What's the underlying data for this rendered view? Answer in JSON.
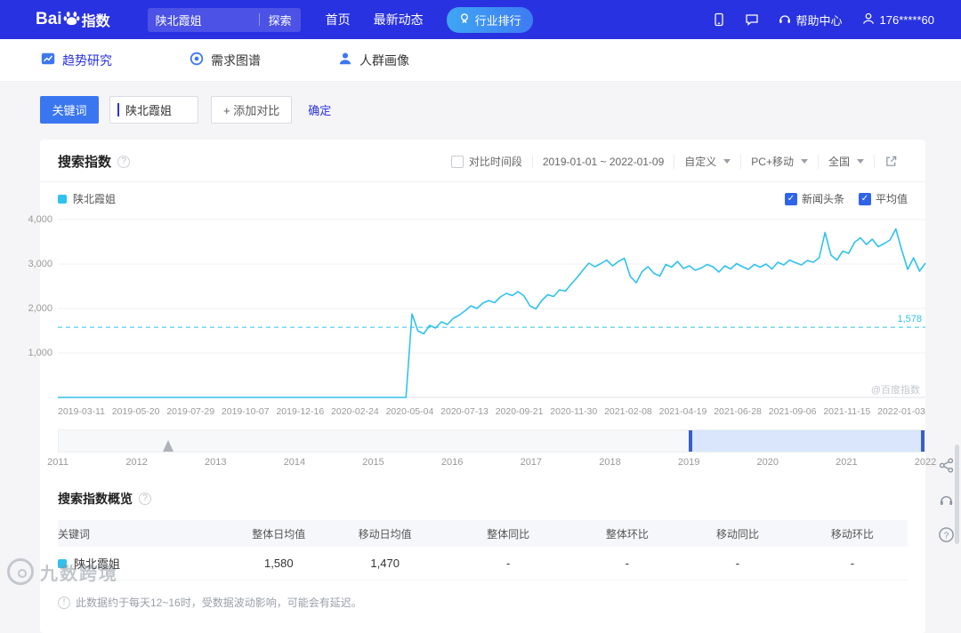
{
  "topbar": {
    "logo_text": "Bai",
    "logo_suffix": "指数",
    "search_value": "陕北霞姐",
    "search_button": "探索",
    "nav_home": "首页",
    "nav_latest": "最新动态",
    "industry_ranking": "行业排行",
    "help_center": "帮助中心",
    "account": "176*****60"
  },
  "subnav": {
    "trend": "趋势研究",
    "demand": "需求图谱",
    "portrait": "人群画像"
  },
  "keyword_bar": {
    "keyword_button": "关键词",
    "keyword_value": "陕北霞姐",
    "add_compare": "+ 添加对比",
    "confirm": "确定"
  },
  "panel": {
    "title": "搜索指数",
    "compare_period": "对比时间段",
    "date_range": "2019-01-01 ~ 2022-01-09",
    "custom": "自定义",
    "device": "PC+移动",
    "region": "全国",
    "legend": "陕北霞姐",
    "news_toggle": "新闻头条",
    "avg_toggle": "平均值",
    "watermark": "@百度指数"
  },
  "chart_data": {
    "type": "line",
    "title": "搜索指数",
    "legend_position": "top-left",
    "grid": true,
    "ylim": [
      0,
      4000
    ],
    "y_ticks": [
      0,
      1000,
      2000,
      3000,
      4000
    ],
    "y_tick_labels": [
      "1,000",
      "2,000",
      "3,000",
      "4,000"
    ],
    "x_tick_labels": [
      "2019-03-11",
      "2019-05-20",
      "2019-07-29",
      "2019-10-07",
      "2019-12-16",
      "2020-02-24",
      "2020-05-04",
      "2020-07-13",
      "2020-09-21",
      "2020-11-30",
      "2021-02-08",
      "2021-04-19",
      "2021-06-28",
      "2021-09-06",
      "2021-11-15",
      "2022-01-03"
    ],
    "average": 1578,
    "average_label": "1,578",
    "series": [
      {
        "name": "陕北霞姐",
        "color": "#2fc2ee",
        "values": [
          0,
          0,
          0,
          0,
          0,
          0,
          0,
          0,
          0,
          0,
          0,
          0,
          0,
          0,
          0,
          0,
          0,
          0,
          0,
          0,
          0,
          0,
          0,
          0,
          0,
          0,
          0,
          0,
          0,
          0,
          0,
          0,
          0,
          0,
          0,
          0,
          0,
          0,
          0,
          0,
          0,
          0,
          0,
          0,
          0,
          0,
          0,
          0,
          0,
          0,
          0,
          0,
          0,
          0,
          0,
          0,
          0,
          0,
          0,
          0,
          1880,
          1500,
          1430,
          1620,
          1560,
          1700,
          1640,
          1780,
          1850,
          1950,
          2060,
          2000,
          2120,
          2180,
          2130,
          2260,
          2340,
          2290,
          2380,
          2280,
          2060,
          1990,
          2180,
          2310,
          2270,
          2420,
          2390,
          2550,
          2700,
          2870,
          3020,
          2940,
          3010,
          3090,
          2960,
          3060,
          3130,
          2720,
          2580,
          2830,
          2940,
          2790,
          2730,
          2990,
          2930,
          3060,
          2900,
          2960,
          2860,
          2910,
          2990,
          2940,
          2820,
          2960,
          2890,
          3010,
          2940,
          2880,
          2990,
          2930,
          3000,
          2890,
          3040,
          2980,
          3090,
          3030,
          2980,
          3080,
          3040,
          3140,
          3710,
          3200,
          3090,
          3290,
          3240,
          3490,
          3590,
          3440,
          3560,
          3390,
          3460,
          3540,
          3790,
          3310,
          2880,
          3140,
          2840,
          3020
        ]
      }
    ]
  },
  "slider": {
    "years": [
      "2011",
      "2012",
      "2013",
      "2014",
      "2015",
      "2016",
      "2017",
      "2018",
      "2019",
      "2020",
      "2021",
      "2022"
    ],
    "start_frac": 0.7273,
    "end_frac": 1.0
  },
  "overview": {
    "title": "搜索指数概览",
    "columns": [
      "关键词",
      "整体日均值",
      "移动日均值",
      "整体同比",
      "整体环比",
      "移动同比",
      "移动环比"
    ],
    "rows": [
      {
        "keyword": "陕北霞姐",
        "color": "#2fc2ee",
        "cells": [
          "1,580",
          "1,470",
          "-",
          "-",
          "-",
          "-"
        ]
      }
    ],
    "note": "此数据约于每天12~16时，受数据波动影响，可能会有延迟。"
  },
  "page_watermark": "九数跨境"
}
